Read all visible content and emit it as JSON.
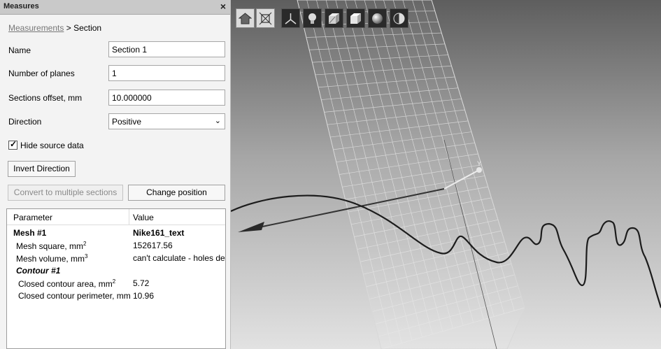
{
  "panel": {
    "title": "Measures",
    "close_symbol": "×",
    "breadcrumb": {
      "link": "Measurements",
      "separator": " > ",
      "current": "Section"
    },
    "fields": {
      "name_label": "Name",
      "name_value": "Section 1",
      "planes_label": "Number of planes",
      "planes_value": "1",
      "offset_label": "Sections offset, mm",
      "offset_value": "10.000000",
      "direction_label": "Direction",
      "direction_value": "Positive"
    },
    "hide_source": {
      "label": "Hide source data",
      "checked": true
    },
    "buttons": {
      "invert": "Invert Direction",
      "convert": "Convert to multiple sections",
      "change_position": "Change position"
    },
    "table": {
      "headers": [
        "Parameter",
        "Value"
      ],
      "rows": [
        {
          "param": "Mesh #1",
          "value": "Nike161_text"
        },
        {
          "param": "Mesh square, mm",
          "sup": "2",
          "value": "152617.56"
        },
        {
          "param": "Mesh volume, mm",
          "sup": "3",
          "value": "can't calculate - holes dete"
        },
        {
          "param": "Contour #1",
          "value": ""
        },
        {
          "param": "Closed contour area, mm",
          "sup": "2",
          "value": "5.72"
        },
        {
          "param": "Closed contour perimeter, mm",
          "value": "10.96"
        }
      ]
    }
  },
  "viewport": {
    "axis_label": "Y",
    "toolbar": [
      {
        "name": "home-view-icon",
        "active": true
      },
      {
        "name": "fit-all-icon",
        "active": true
      },
      {
        "name": "axes-icon",
        "active": false
      },
      {
        "name": "light-bulb-icon",
        "active": false
      },
      {
        "name": "textured-cube-icon",
        "active": false
      },
      {
        "name": "shaded-cube-icon",
        "active": false
      },
      {
        "name": "sphere-icon",
        "active": false
      },
      {
        "name": "half-moon-icon",
        "active": false
      }
    ]
  }
}
